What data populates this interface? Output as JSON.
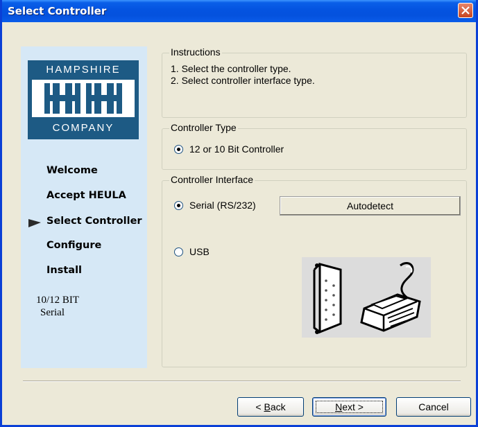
{
  "window": {
    "title": "Select Controller"
  },
  "logo": {
    "top_text": "HAMPSHIRE",
    "bottom_text": "COMPANY"
  },
  "nav": {
    "items": [
      {
        "label": "Welcome"
      },
      {
        "label": "Accept HEULA"
      },
      {
        "label": "Select Controller",
        "current": true
      },
      {
        "label": "Configure"
      },
      {
        "label": "Install"
      }
    ]
  },
  "status": {
    "line1": "10/12 BIT",
    "line2": "Serial"
  },
  "instructions": {
    "legend": "Instructions",
    "line1": "1. Select the controller type.",
    "line2": "2. Select controller interface type."
  },
  "controller_type": {
    "legend": "Controller Type",
    "option1": {
      "label": "12 or 10 Bit Controller",
      "checked": true
    }
  },
  "controller_interface": {
    "legend": "Controller Interface",
    "serial": {
      "label": "Serial (RS/232)",
      "checked": true
    },
    "usb": {
      "label": "USB",
      "checked": false
    },
    "autodetect_label": "Autodetect"
  },
  "buttons": {
    "back": {
      "prefix": "< ",
      "mnemonic": "B",
      "rest": "ack"
    },
    "next": {
      "mnemonic": "N",
      "rest": "ext >"
    },
    "cancel": "Cancel"
  },
  "icons": {
    "close": "close-icon",
    "arrow": "current-step-arrow-icon",
    "db9": "db9-connector-icon",
    "usb": "usb-cable-icon"
  },
  "colors": {
    "titlebar": "#0453e0",
    "sidepanel": "#d6e8f6",
    "logo": "#1d5a84",
    "dialog": "#ece9d8"
  }
}
